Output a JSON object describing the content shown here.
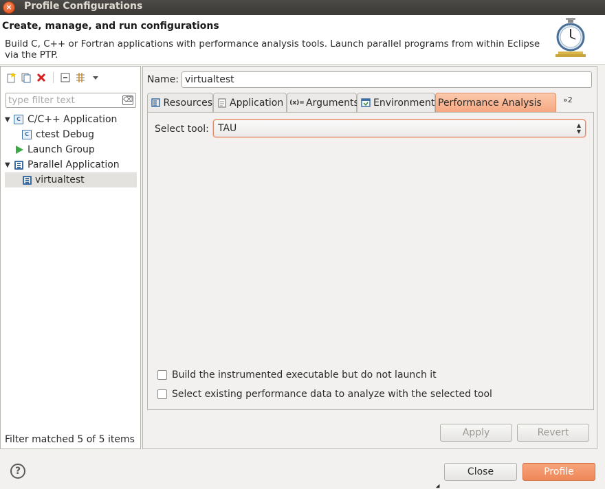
{
  "window": {
    "title": "Profile Configurations",
    "close_glyph": "×"
  },
  "header": {
    "title": "Create, manage, and run configurations",
    "description": "Build C, C++ or Fortran applications with performance analysis tools.  Launch parallel programs from within Eclipse via the PTP."
  },
  "left_panel": {
    "filter_placeholder": "type filter text",
    "filter_clear_glyph": "⌫",
    "tree": [
      {
        "label": "C/C++ Application",
        "expanded": true,
        "icon": "c-app-icon"
      },
      {
        "label": "ctest Debug",
        "icon": "c-config-icon"
      },
      {
        "label": "Launch Group",
        "icon": "launch-group-icon"
      },
      {
        "label": "Parallel Application",
        "expanded": true,
        "icon": "parallel-app-icon"
      },
      {
        "label": "virtualtest",
        "selected": true,
        "icon": "parallel-config-icon"
      }
    ],
    "status": "Filter matched 5 of 5 items"
  },
  "right_panel": {
    "name_label": "Name:",
    "name_value": "virtualtest",
    "tabs": [
      {
        "label": "Resources",
        "icon": "resources-icon"
      },
      {
        "label": "Application",
        "icon": "application-icon"
      },
      {
        "label": "Arguments",
        "icon": "arguments-icon",
        "glyph": "(x)="
      },
      {
        "label": "Environment",
        "icon": "environment-icon"
      },
      {
        "label": "Performance Analysis",
        "active": true
      }
    ],
    "more_tabs": "»2",
    "select_tool_label": "Select tool:",
    "select_tool_value": "TAU",
    "checkbox_build": "Build the instrumented executable but do not launch it",
    "checkbox_select": "Select existing performance data to analyze with the selected tool",
    "apply_label": "Apply",
    "revert_label": "Revert"
  },
  "footer": {
    "help_glyph": "?",
    "close_label": "Close",
    "profile_label": "Profile"
  },
  "colors": {
    "active_tab": "#f6a882",
    "primary_button": "#ee8758",
    "titlebar": "#3b3a37"
  }
}
